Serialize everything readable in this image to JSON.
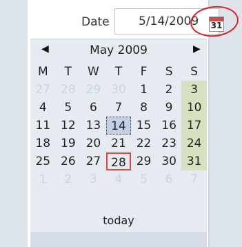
{
  "date_field": {
    "label": "Date",
    "value": "5/14/2009",
    "calendar_icon_day": "31"
  },
  "calendar": {
    "title": "May 2009",
    "prev_symbol": "◀",
    "next_symbol": "▶",
    "weekdays": [
      "M",
      "T",
      "W",
      "T",
      "F",
      "S",
      "S"
    ],
    "weeks": [
      [
        "27",
        "28",
        "29",
        "30",
        "1",
        "2",
        "3"
      ],
      [
        "4",
        "5",
        "6",
        "7",
        "8",
        "9",
        "10"
      ],
      [
        "11",
        "12",
        "13",
        "14",
        "15",
        "16",
        "17"
      ],
      [
        "18",
        "19",
        "20",
        "21",
        "22",
        "23",
        "24"
      ],
      [
        "25",
        "26",
        "27",
        "28",
        "29",
        "30",
        "31"
      ],
      [
        "1",
        "2",
        "3",
        "4",
        "5",
        "6",
        "7"
      ]
    ],
    "today_label": "today"
  }
}
